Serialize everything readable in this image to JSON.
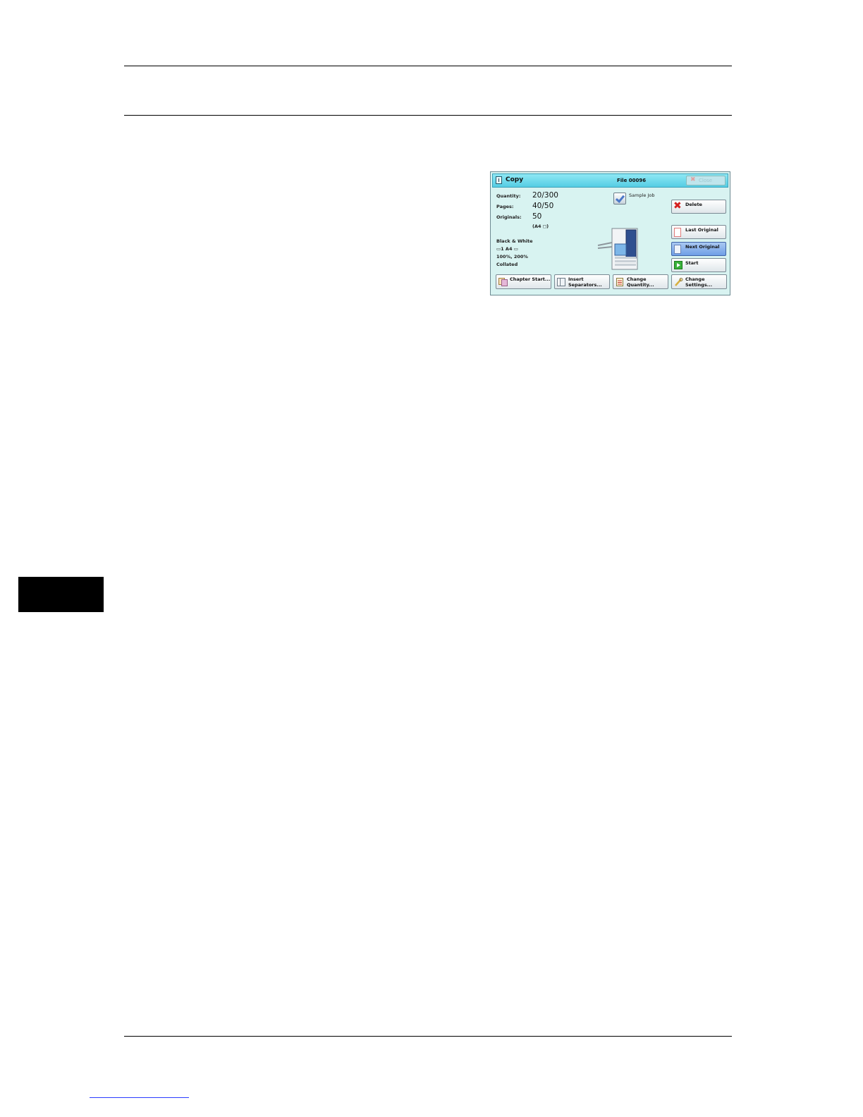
{
  "panel": {
    "title": "Copy",
    "file_label": "File 00096",
    "close_label": "Close",
    "info": {
      "quantity_label": "Quantity:",
      "quantity_value": "20/300",
      "pages_label": "Pages:",
      "pages_value": "40/50",
      "originals_label": "Originals:",
      "originals_value": "50",
      "originals_size": "(A4 ◻)",
      "color_mode": "Black & White",
      "tray_size": "▭1   A4 ▭",
      "reduction": "100%, 200%",
      "collation": "Collated"
    },
    "sample_job_label": "Sample Job",
    "buttons": {
      "delete": "Delete",
      "last_original": "Last Original",
      "next_original": "Next Original",
      "start": "Start"
    },
    "bottom_buttons": {
      "chapter_start": "Chapter Start...",
      "insert_separators_1": "Insert",
      "insert_separators_2": "Separators...",
      "change_quantity_1": "Change",
      "change_quantity_2": "Quantity...",
      "change_settings_1": "Change",
      "change_settings_2": "Settings..."
    }
  }
}
